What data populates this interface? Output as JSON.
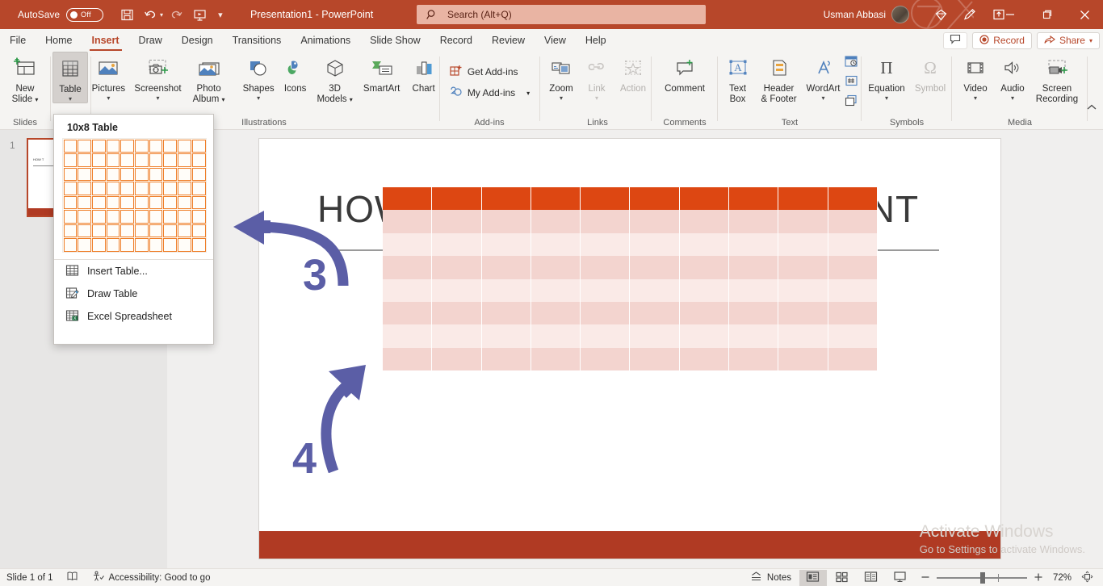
{
  "titlebar": {
    "autosave_label": "AutoSave",
    "autosave_state": "Off",
    "document_title": "Presentation1  -  PowerPoint",
    "save_icon": "save-icon",
    "undo_icon": "undo-icon",
    "redo_icon": "redo-icon",
    "present_icon": "start-presentation-icon",
    "customize_icon": "customize-quick-access-icon",
    "user_name": "Usman Abbasi",
    "diamond_icon": "diamond-icon",
    "pen_icon": "pen-icon",
    "ribbon_display_icon": "ribbon-display-options-icon",
    "minimize_icon": "minimize-icon",
    "restore_icon": "restore-icon",
    "close_icon": "close-icon"
  },
  "search": {
    "placeholder": "Search (Alt+Q)",
    "icon": "search-icon"
  },
  "tabs": [
    {
      "label": "File",
      "active": false
    },
    {
      "label": "Home",
      "active": false
    },
    {
      "label": "Insert",
      "active": true
    },
    {
      "label": "Draw",
      "active": false
    },
    {
      "label": "Design",
      "active": false
    },
    {
      "label": "Transitions",
      "active": false
    },
    {
      "label": "Animations",
      "active": false
    },
    {
      "label": "Slide Show",
      "active": false
    },
    {
      "label": "Record",
      "active": false
    },
    {
      "label": "Review",
      "active": false
    },
    {
      "label": "View",
      "active": false
    },
    {
      "label": "Help",
      "active": false
    }
  ],
  "tabbar_right": {
    "comments_label": "",
    "comments_icon": "comment-icon",
    "record_label": "Record",
    "record_icon": "record-dot-icon",
    "share_label": "Share",
    "share_icon": "share-icon",
    "share_caret": "chevron-down-icon"
  },
  "ribbon": {
    "groups": [
      {
        "name": "Slides",
        "buttons": [
          {
            "label": "New\nSlide",
            "label_line1": "New",
            "label_line2": "Slide",
            "icon": "new-slide-icon",
            "has_caret": true,
            "disabled": false,
            "active": false
          }
        ]
      },
      {
        "name": "",
        "buttons": [
          {
            "label_line1": "Table",
            "label_line2": "",
            "icon": "table-icon",
            "has_caret": true,
            "disabled": false,
            "active": true
          }
        ]
      },
      {
        "name": "Illustrations",
        "buttons": [
          {
            "label_line1": "Pictures",
            "label_line2": "",
            "icon": "pictures-icon",
            "has_caret": true,
            "disabled": false,
            "active": false
          },
          {
            "label_line1": "Screenshot",
            "label_line2": "",
            "icon": "screenshot-icon",
            "has_caret": true,
            "disabled": false,
            "active": false
          },
          {
            "label_line1": "Photo",
            "label_line2": "Album",
            "icon": "photo-album-icon",
            "has_caret": true,
            "disabled": false,
            "active": false
          },
          {
            "label_line1": "Shapes",
            "label_line2": "",
            "icon": "shapes-icon",
            "has_caret": true,
            "disabled": false,
            "active": false
          },
          {
            "label_line1": "Icons",
            "label_line2": "",
            "icon": "icons-icon",
            "has_caret": false,
            "disabled": false,
            "active": false
          },
          {
            "label_line1": "3D",
            "label_line2": "Models",
            "icon": "3d-models-icon",
            "has_caret": true,
            "disabled": false,
            "active": false
          },
          {
            "label_line1": "SmartArt",
            "label_line2": "",
            "icon": "smartart-icon",
            "has_caret": false,
            "disabled": false,
            "active": false
          },
          {
            "label_line1": "Chart",
            "label_line2": "",
            "icon": "chart-icon",
            "has_caret": false,
            "disabled": false,
            "active": false
          }
        ]
      },
      {
        "name": "Add-ins",
        "buttons": [
          {
            "label_line1": "Get Add-ins",
            "icon": "get-addins-icon",
            "has_caret": false,
            "disabled": false,
            "active": false
          },
          {
            "label_line1": "My Add-ins",
            "icon": "my-addins-icon",
            "has_caret": true,
            "disabled": false,
            "active": false
          }
        ]
      },
      {
        "name": "Links",
        "buttons": [
          {
            "label_line1": "Zoom",
            "label_line2": "",
            "icon": "zoom-icon",
            "has_caret": true,
            "disabled": false,
            "active": false
          },
          {
            "label_line1": "Link",
            "label_line2": "",
            "icon": "link-icon",
            "has_caret": true,
            "disabled": true,
            "active": false
          },
          {
            "label_line1": "Action",
            "label_line2": "",
            "icon": "action-icon",
            "has_caret": false,
            "disabled": true,
            "active": false
          }
        ]
      },
      {
        "name": "Comments",
        "buttons": [
          {
            "label_line1": "Comment",
            "label_line2": "",
            "icon": "new-comment-icon",
            "has_caret": false,
            "disabled": false,
            "active": false
          }
        ]
      },
      {
        "name": "Text",
        "buttons": [
          {
            "label_line1": "Text",
            "label_line2": "Box",
            "icon": "text-box-icon",
            "has_caret": false,
            "disabled": false,
            "active": false
          },
          {
            "label_line1": "Header",
            "label_line2": "& Footer",
            "icon": "header-footer-icon",
            "has_caret": false,
            "disabled": false,
            "active": false
          },
          {
            "label_line1": "WordArt",
            "label_line2": "",
            "icon": "wordart-icon",
            "has_caret": true,
            "disabled": false,
            "active": false
          }
        ],
        "stacked_icons": [
          "date-time-icon",
          "slide-number-icon",
          "object-icon"
        ]
      },
      {
        "name": "Symbols",
        "buttons": [
          {
            "label_line1": "Equation",
            "label_line2": "",
            "icon": "equation-icon",
            "has_caret": true,
            "disabled": false,
            "active": false
          },
          {
            "label_line1": "Symbol",
            "label_line2": "",
            "icon": "symbol-icon",
            "has_caret": false,
            "disabled": true,
            "active": false
          }
        ]
      },
      {
        "name": "Media",
        "buttons": [
          {
            "label_line1": "Video",
            "label_line2": "",
            "icon": "video-icon",
            "has_caret": true,
            "disabled": false,
            "active": false
          },
          {
            "label_line1": "Audio",
            "label_line2": "",
            "icon": "audio-icon",
            "has_caret": true,
            "disabled": false,
            "active": false
          },
          {
            "label_line1": "Screen",
            "label_line2": "Recording",
            "icon": "screen-recording-icon",
            "has_caret": false,
            "disabled": false,
            "active": false
          }
        ]
      }
    ],
    "collapse_icon": "collapse-ribbon-icon"
  },
  "table_dropdown": {
    "header": "10x8 Table",
    "grid": {
      "columns": 10,
      "rows": 8,
      "selected_columns": 10,
      "selected_rows": 8
    },
    "menu_items": [
      {
        "label": "Insert Table...",
        "icon": "insert-table-icon"
      },
      {
        "label": "Draw Table",
        "icon": "draw-table-icon"
      },
      {
        "label": "Excel Spreadsheet",
        "icon": "excel-spreadsheet-icon"
      }
    ]
  },
  "thumbnail_pane": {
    "slide_number": "1",
    "slide_title_snippet": "HOW T"
  },
  "slide": {
    "title_left": "HOW",
    "title_right": "INT",
    "table": {
      "columns": 10,
      "rows": 8,
      "header_color": "#dd4712",
      "body_color": "#f3d4cf",
      "alt_color": "#faeae7"
    },
    "annotations": [
      {
        "number": "3",
        "arrow": "curved-arrow-left"
      },
      {
        "number": "4",
        "arrow": "curved-arrow-up-right"
      }
    ]
  },
  "watermark": {
    "line1": "Activate Windows",
    "line2": "Go to Settings to activate Windows."
  },
  "statusbar": {
    "slide_counter": "Slide 1 of 1",
    "language_icon": "language-icon",
    "accessibility_icon": "accessibility-icon",
    "accessibility_text": "Accessibility: Good to go",
    "notes_label": "Notes",
    "notes_icon": "notes-icon",
    "views": [
      {
        "name": "normal-view",
        "icon": "normal-view-icon",
        "active": true
      },
      {
        "name": "slide-sorter-view",
        "icon": "slide-sorter-icon",
        "active": false
      },
      {
        "name": "reading-view",
        "icon": "reading-view-icon",
        "active": false
      },
      {
        "name": "slide-show-view",
        "icon": "slide-show-icon",
        "active": false
      }
    ],
    "zoom_out_icon": "zoom-out-icon",
    "zoom_in_icon": "zoom-in-icon",
    "zoom_level": "72%",
    "fit_icon": "fit-to-window-icon"
  },
  "colors": {
    "titlebar": "#b7472a",
    "ribbon_bg": "#f5f4f2",
    "accent_orange": "#ef7f2a",
    "table_header": "#dd4712",
    "annotation_purple": "#5b5ea6"
  }
}
